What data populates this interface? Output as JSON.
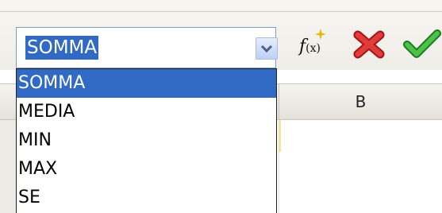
{
  "function_box": {
    "value": "SOMMA",
    "options": [
      "SOMMA",
      "MEDIA",
      "MIN",
      "MAX",
      "SE"
    ],
    "selected_index": 0
  },
  "toolbar": {
    "function_wizard_label": "f(x)",
    "function_wizard_main": "f",
    "function_wizard_sub": "(x)",
    "icons": [
      "function-wizard-icon",
      "cancel-icon",
      "accept-icon"
    ]
  },
  "sheet": {
    "column_headers": [
      "B"
    ]
  },
  "colors": {
    "selection": "#316ac5",
    "cancel": "#d42222",
    "accept": "#2e9b2e"
  }
}
